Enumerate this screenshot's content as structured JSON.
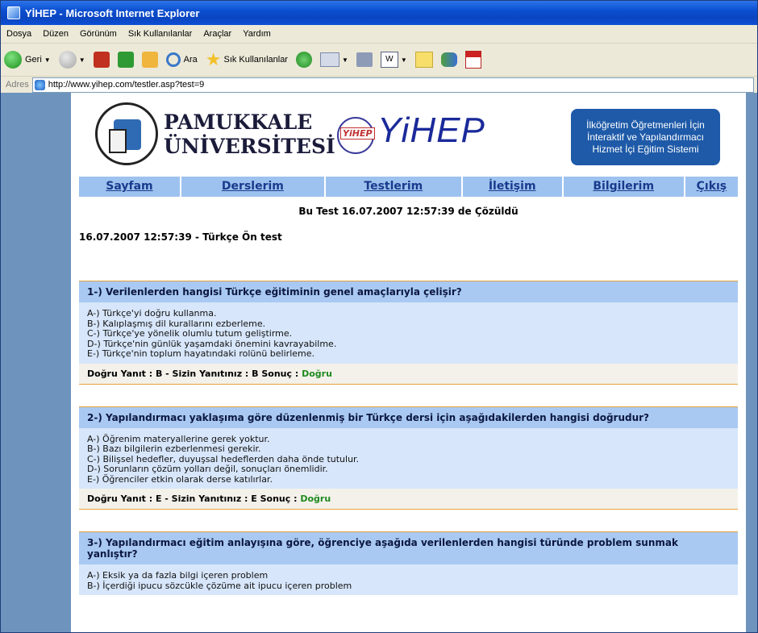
{
  "window": {
    "title": "YİHEP - Microsoft Internet Explorer"
  },
  "menu": [
    "Dosya",
    "Düzen",
    "Görünüm",
    "Sık Kullanılanlar",
    "Araçlar",
    "Yardım"
  ],
  "toolbar": {
    "back_label": "Geri",
    "search_label": "Ara",
    "favorites_label": "Sık Kullanılanlar",
    "word_label": "W"
  },
  "address": {
    "label": "Adres",
    "url": "http://www.yihep.com/testler.asp?test=9"
  },
  "header": {
    "university_line1": "PAMUKKALE",
    "university_line2": "ÜNİVERSİTESİ",
    "brand": "YiHEP",
    "globe_tag": "YiHEP",
    "tagline1": "İlköğretim Öğretmenleri İçin",
    "tagline2": "İnteraktif ve Yapılandırmacı",
    "tagline3": "Hizmet İçi Eğitim Sistemi"
  },
  "nav": [
    "Sayfam",
    "Derslerim",
    "Testlerim",
    "İletişim",
    "Bilgilerim",
    "Çıkış"
  ],
  "solved_text": "Bu Test 16.07.2007 12:57:39 de Çözüldü",
  "test_title": "16.07.2007 12:57:39 - Türkçe Ön test",
  "questions": [
    {
      "title": "1-) Verilenlerden hangisi Türkçe eğitiminin genel amaçlarıyla çelişir?",
      "options": [
        "A-) Türkçe'yi doğru kullanma.",
        "B-) Kalıplaşmış dil kurallarını ezberleme.",
        "C-) Türkçe'ye yönelik olumlu tutum geliştirme.",
        "D-) Türkçe'nin günlük yaşamdaki önemini kavrayabilme.",
        "E-) Türkçe'nin toplum hayatındaki rolünü belirleme."
      ],
      "result_prefix": "Doğru Yanıt : B - Sizin Yanıtınız : B  Sonuç : ",
      "result": "Doğru"
    },
    {
      "title": "2-) Yapılandırmacı yaklaşıma göre düzenlenmiş bir Türkçe dersi için aşağıdakilerden hangisi doğrudur?",
      "options": [
        "A-) Öğrenim materyallerine gerek yoktur.",
        "B-) Bazı bilgilerin ezberlenmesi gerekir.",
        "C-) Bilişsel hedefler, duyuşsal hedeflerden daha önde tutulur.",
        "D-) Sorunların çözüm yolları değil, sonuçları önemlidir.",
        "E-) Öğrenciler etkin olarak derse katılırlar."
      ],
      "result_prefix": "Doğru Yanıt : E - Sizin Yanıtınız : E  Sonuç : ",
      "result": "Doğru"
    },
    {
      "title": "3-) Yapılandırmacı eğitim anlayışına göre, öğrenciye aşağıda verilenlerden hangisi türünde problem sunmak yanlıştır?",
      "options": [
        "A-) Eksik ya da fazla bilgi içeren problem",
        "B-) İçerdiği ipucu sözcükle çözüme ait ipucu içeren problem"
      ],
      "result_prefix": "",
      "result": ""
    }
  ]
}
